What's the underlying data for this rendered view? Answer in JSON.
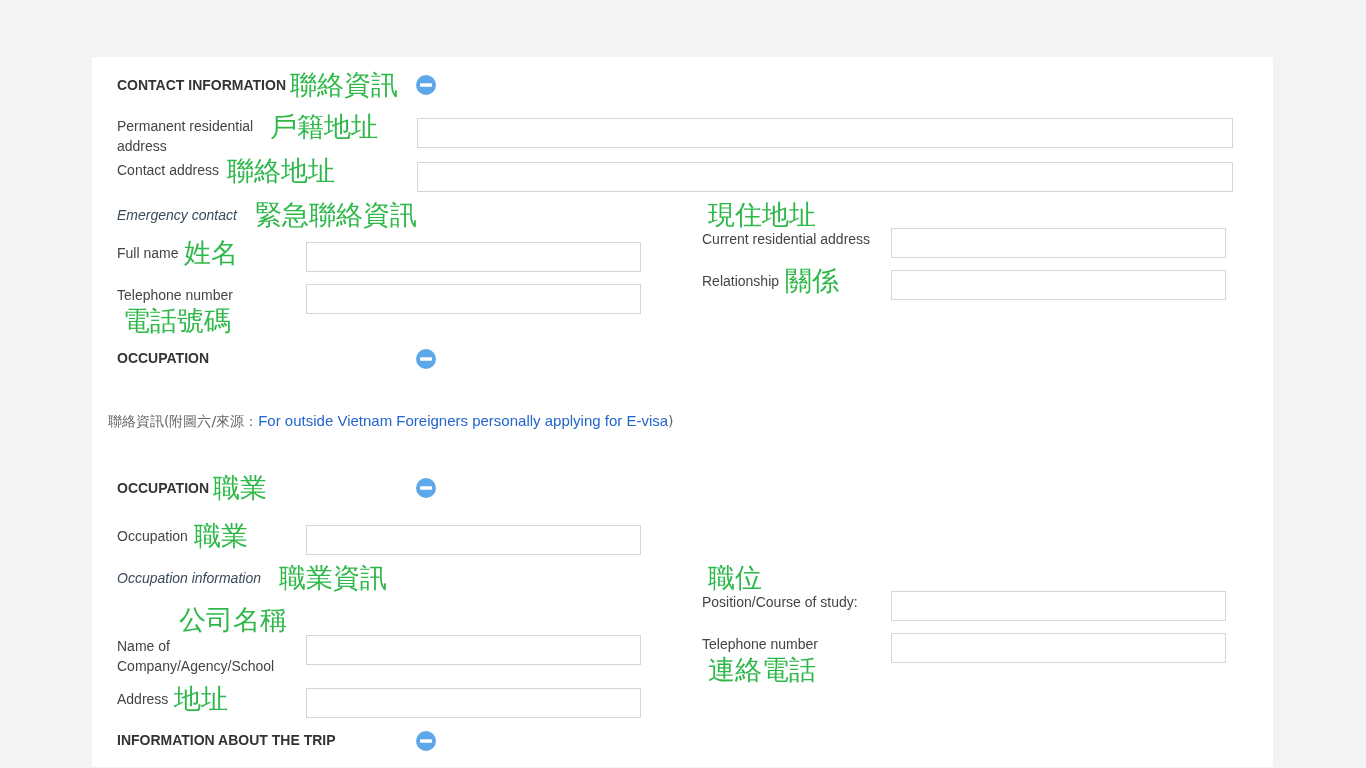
{
  "panels": [
    {
      "sections": [
        {
          "heading": "CONTACT INFORMATION",
          "note": "聯絡資訊",
          "wide_fields": [
            {
              "label": "Permanent residential address",
              "note": "戶籍地址"
            },
            {
              "label": "Contact address",
              "note": "聯絡地址"
            }
          ],
          "group": {
            "subheading": "Emergency contact",
            "subnote": "緊急聯絡資訊",
            "left": [
              {
                "label": "Full name",
                "note": "姓名",
                "kind": "beside"
              },
              {
                "label": "Telephone number",
                "note": "電話號碼",
                "kind": "below"
              }
            ],
            "right": [
              {
                "label": "Current residential address",
                "note": "現住地址",
                "kind": "above"
              },
              {
                "label": "Relationship",
                "note": "關係",
                "kind": "beside"
              }
            ]
          }
        },
        {
          "heading": "OCCUPATION"
        }
      ]
    },
    {
      "sections": [
        {
          "heading": "OCCUPATION",
          "note": "職業",
          "single_fields": [
            {
              "label": "Occupation",
              "note": "職業",
              "kind": "beside"
            }
          ],
          "group": {
            "subheading": "Occupation information",
            "subnote": "職業資訊",
            "left": [
              {
                "label": "Name of Company/Agency/School",
                "note": "公司名稱",
                "kind": "overlay"
              },
              {
                "label": "Address",
                "note": "地址",
                "kind": "beside"
              }
            ],
            "right": [
              {
                "label": "Position/Course of study:",
                "note": "職位",
                "kind": "above"
              },
              {
                "label": "Telephone number",
                "note": "連絡電話",
                "kind": "below"
              }
            ]
          }
        },
        {
          "heading": "INFORMATION ABOUT THE TRIP"
        }
      ]
    }
  ],
  "caption": {
    "prefix": "聯絡資訊(附圖六/來源：",
    "link": "For outside Vietnam Foreigners personally applying for E-visa",
    "suffix": ")"
  }
}
